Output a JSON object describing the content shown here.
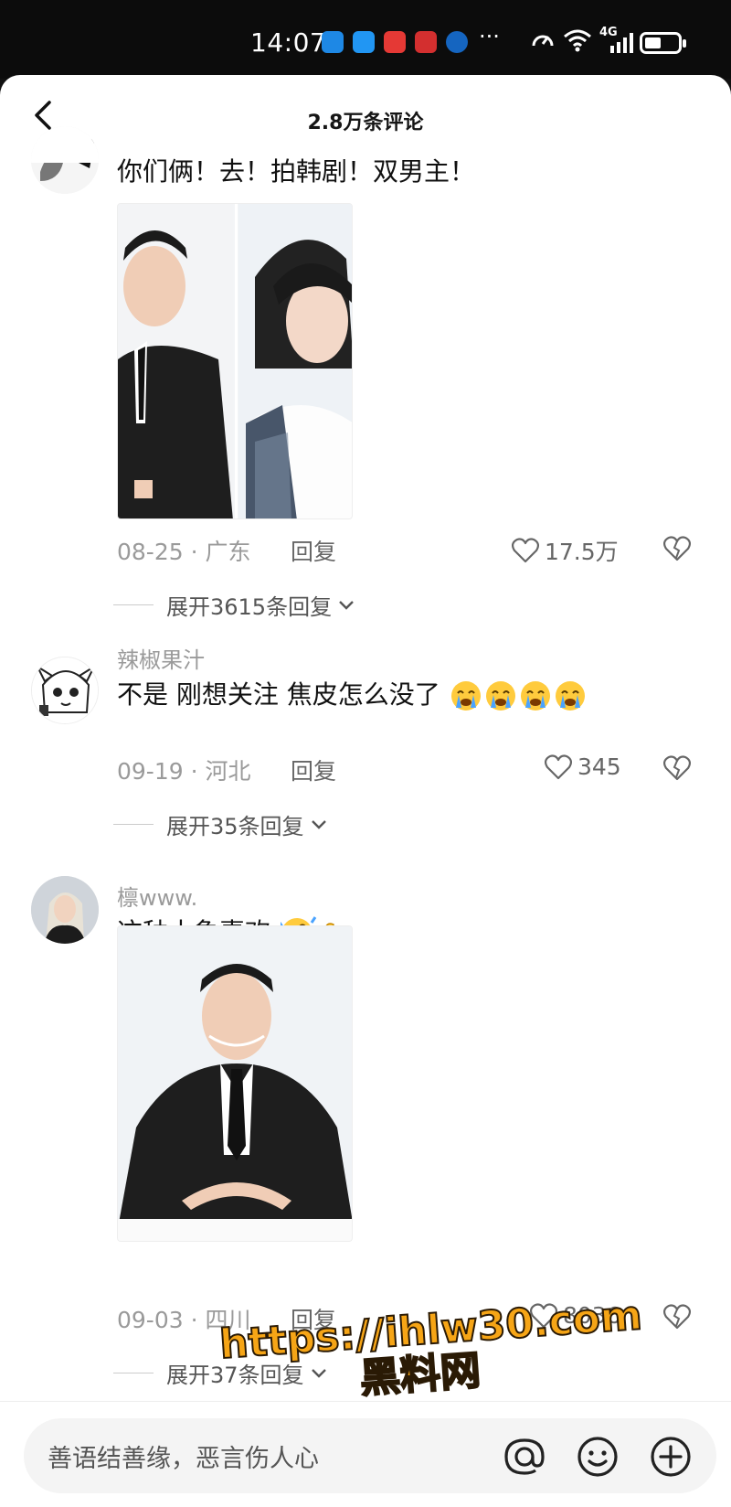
{
  "status_bar": {
    "time": "14:07",
    "dots": "···",
    "network": "4G"
  },
  "header": {
    "title": "2.8万条评论"
  },
  "comments": [
    {
      "username": "",
      "content": "你们俩！去！拍韩剧！双男主！",
      "date": "08-25",
      "region": "广东",
      "reply_label": "回复",
      "likes": "17.5万",
      "expand_label": "展开3615条回复"
    },
    {
      "username": "辣椒果汁",
      "content": "不是 刚想关注 焦皮怎么没了",
      "date": "09-19",
      "region": "河北",
      "reply_label": "回复",
      "likes": "345",
      "expand_label": "展开35条回复"
    },
    {
      "username": "檩www.",
      "content": "这种土象喜欢",
      "date": "09-03",
      "region": "四川",
      "reply_label": "回复",
      "likes": "8036",
      "expand_label": "展开37条回复"
    }
  ],
  "input": {
    "placeholder": "善语结善缘，恶言伤人心"
  },
  "watermark": {
    "line1": "https://ihlw30.com",
    "line2": "黑料网"
  },
  "colors": {
    "accent": "#f6a516",
    "muted": "#9a9a9a",
    "text": "#111111"
  },
  "icons": [
    "back-icon",
    "heart-icon",
    "broken-heart-icon",
    "chevron-down-icon",
    "at-icon",
    "emoji-icon",
    "plus-icon"
  ]
}
